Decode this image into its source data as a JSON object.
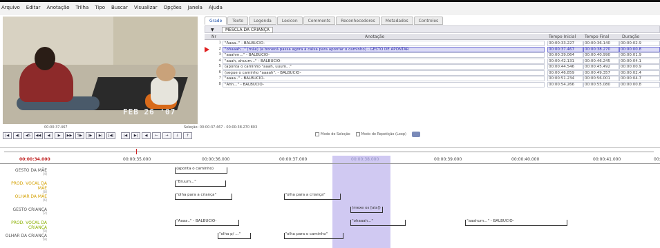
{
  "menu": [
    "Arquivo",
    "Editar",
    "Anotação",
    "Trilha",
    "Tipo",
    "Buscar",
    "Visualizar",
    "Opções",
    "Janela",
    "Ajuda"
  ],
  "video": {
    "timestamp": "FEB 26 '07"
  },
  "tabs": [
    "Grade",
    "Texto",
    "Legenda",
    "Lexicon",
    "Comments",
    "Reconhecedores",
    "Metadados",
    "Controles"
  ],
  "tier_selector": {
    "arrow": "▼",
    "name": "MESCLA DA CRIANÇA"
  },
  "grid": {
    "header_nr": "Nr",
    "header_annotation": "Anotação",
    "header_begin": "Tempo Inicial",
    "header_end": "Tempo Final",
    "header_duration": "Duração",
    "rows": [
      {
        "num": "1",
        "text": "\"Aaaa..\" - BALBUCIO-",
        "begin": "00:00:33.227",
        "end": "00:00:36.140",
        "dur": "00:00:02.9"
      },
      {
        "num": "2",
        "text": "\"ohaaah...\" (mãe) (a bonecá passa agora à caixa para apontar o caminho) - GESTO DE APONTAR",
        "begin": "00:00:37.467",
        "end": "00:00:38.270",
        "dur": "00:00:00.8"
      },
      {
        "num": "3",
        "text": "\"aaahm...\" - BALBUCIO-",
        "begin": "00:00:39.064",
        "end": "00:00:40.990",
        "dur": "00:00:01.9"
      },
      {
        "num": "4",
        "text": "\"aaah, ahuum...\" - BALBUCIO-",
        "begin": "00:00:42.131",
        "end": "00:00:46.245",
        "dur": "00:00:04.1"
      },
      {
        "num": "5",
        "text": "(aponta o caminho \"aaah, uuum...\"",
        "begin": "00:00:44.546",
        "end": "00:00:45.492",
        "dur": "00:00:00.9"
      },
      {
        "num": "6",
        "text": "(segue o caminho \"aaaah\". - BALBUCIO-",
        "begin": "00:00:46.859",
        "end": "00:00:49.357",
        "dur": "00:00:02.4"
      },
      {
        "num": "7",
        "text": "\"aaaa..\" - BALBUCIO-",
        "begin": "00:00:51.234",
        "end": "00:00:56.001",
        "dur": "00:00:04.7"
      },
      {
        "num": "8",
        "text": "\"Ahh...\" - BALBUCIO-",
        "begin": "00:00:54.266",
        "end": "00:00:55.080",
        "dur": "00:00:00.8"
      }
    ]
  },
  "controls": {
    "media_time": "00:00:37.467",
    "selection": "Seleção: 00:00:37.467 - 00:00:38.270 803",
    "buttons": [
      "|◀",
      "◀|",
      "◀S",
      "◀◀",
      "◀",
      "▶",
      "▶▶",
      "S▶",
      "|▶",
      "▶|",
      "[◀]"
    ],
    "nav_buttons": [
      "|◀",
      "▶|",
      "◀",
      "←",
      "→",
      "↓",
      "↑"
    ],
    "checks": [
      "Modo de Seleção",
      "Modo de Repetição (Loop)"
    ]
  },
  "ruler": {
    "start": "00:00:34.000",
    "ticks": [
      "00:00:34.000",
      "00:00:35.000",
      "00:00:36.000",
      "00:00:37.000",
      "00:00:38.000",
      "00:00:39.000",
      "00:00:40.000",
      "00:00:41.000",
      "00:00:4"
    ]
  },
  "tiers": [
    {
      "label": "GESTO DA MÃE",
      "n": "[4]",
      "color": "gray",
      "anns": [
        {
          "text": "(aponta o caminho)",
          "from": 0.265,
          "to": 0.345
        }
      ]
    },
    {
      "label": "PROD. VOCAL DA MÃE",
      "n": "[8]",
      "color": "orange",
      "anns": [
        {
          "text": "\"Bruum...\"",
          "from": 0.265,
          "to": 0.342
        }
      ]
    },
    {
      "label": "OLHAR DA MÃE",
      "n": "[6]",
      "color": "orange",
      "anns": [
        {
          "text": "\"olha para a criança\"",
          "from": 0.265,
          "to": 0.352
        },
        {
          "text": "\"olha para a criança\"",
          "from": 0.43,
          "to": 0.516
        }
      ]
    },
    {
      "label": "GESTO CRIANÇA",
      "n": "[2]",
      "color": "gray",
      "anns": [
        {
          "text": "(mexe os [ala])",
          "from": 0.531,
          "to": 0.58
        }
      ]
    },
    {
      "label": "PROD. VOCAL DA CRIANÇA",
      "n": "[9]",
      "color": "green",
      "anns": [
        {
          "text": "\"Aaaa..\" - BALBUCIO-",
          "from": 0.265,
          "to": 0.362
        },
        {
          "text": "\"ohaaah...\"",
          "from": 0.531,
          "to": 0.615
        },
        {
          "text": "\"aaahum...\" - BALBUCIO-",
          "from": 0.705,
          "to": 0.86
        }
      ]
    },
    {
      "label": "OLHAR DA CRIANÇA",
      "n": "[9]",
      "color": "gray",
      "anns": [
        {
          "text": "\"olha p/ ...\"",
          "from": 0.33,
          "to": 0.38
        },
        {
          "text": "\"olha para o caminho\"",
          "from": 0.43,
          "to": 0.52
        }
      ]
    }
  ]
}
